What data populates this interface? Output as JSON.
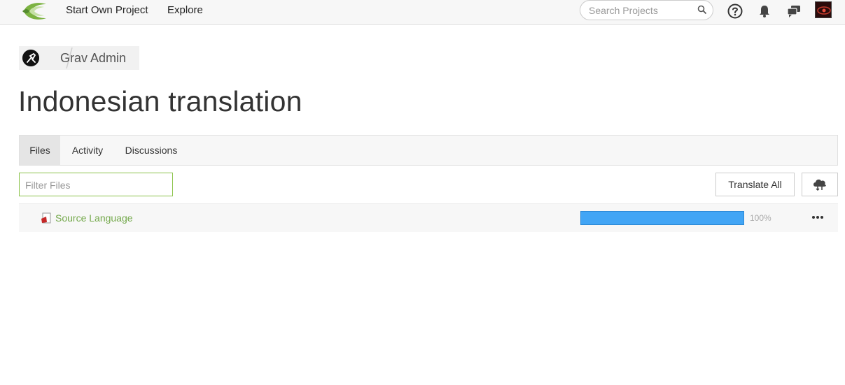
{
  "topbar": {
    "nav": {
      "start_own_project": "Start Own Project",
      "explore": "Explore"
    },
    "search": {
      "placeholder": "Search Projects",
      "value": ""
    },
    "icons": [
      "help-icon",
      "bell-icon",
      "chat-icon",
      "search-icon"
    ]
  },
  "breadcrumb": {
    "project": "Grav Admin"
  },
  "page": {
    "title": "Indonesian translation"
  },
  "tabs": [
    {
      "label": "Files",
      "active": true
    },
    {
      "label": "Activity",
      "active": false
    },
    {
      "label": "Discussions",
      "active": false
    }
  ],
  "filter": {
    "placeholder": "Filter Files",
    "value": ""
  },
  "actions": {
    "translate_all": "Translate All",
    "cloud_icon": "cloud-sync-icon"
  },
  "files": [
    {
      "name": "Source Language",
      "progress": 1.0,
      "progress_label": "100%"
    }
  ],
  "colors": {
    "accent_green": "#8bc34a",
    "link_green": "#73a84a",
    "progress_blue": "#42a5f5"
  }
}
